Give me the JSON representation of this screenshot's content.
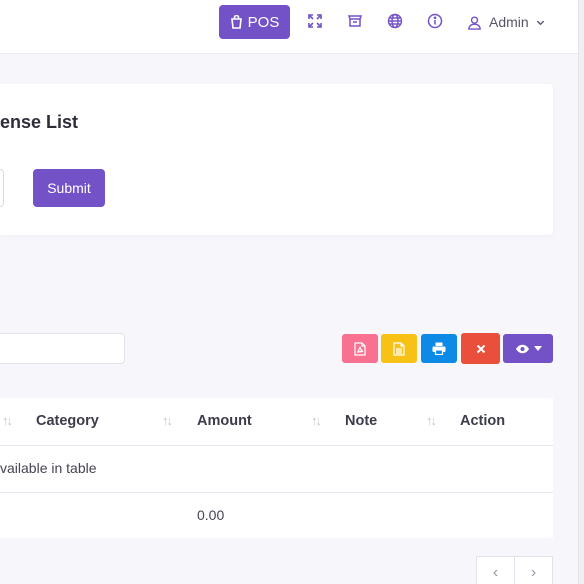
{
  "topbar": {
    "pos_label": "POS",
    "user_name": "Admin",
    "icons": [
      "fullscreen-icon",
      "store-icon",
      "language-globe-icon",
      "info-icon",
      "user-icon"
    ]
  },
  "filter_card": {
    "title": "ense List",
    "submit_label": "Submit"
  },
  "export_buttons": [
    {
      "name": "pdf-export-button",
      "color": "#f87191"
    },
    {
      "name": "csv-export-button",
      "color": "#f7c116"
    },
    {
      "name": "print-button",
      "color": "#0d8ae6"
    },
    {
      "name": "clear-button",
      "color": "#ea4f3c"
    },
    {
      "name": "column-visibility-button",
      "color": "#7352c7"
    }
  ],
  "table": {
    "columns": [
      "Category",
      "Amount",
      "Note",
      "Action"
    ],
    "empty_message": "vailable in table",
    "footer_total": "0.00"
  },
  "pagination": {
    "prev": "‹",
    "next": "›"
  }
}
